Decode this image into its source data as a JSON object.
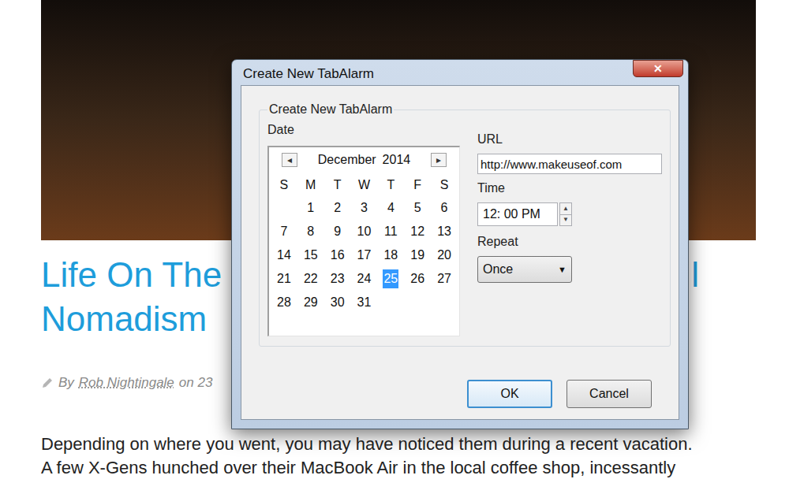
{
  "article": {
    "heading_lines": [
      "Life On The",
      "Nomadism"
    ],
    "heading_fragment": "l",
    "byline": {
      "prefix": "By",
      "author": "Rob Nightingale",
      "suffix": "on 23"
    },
    "body_lines": [
      "Depending on where you went, you may have noticed them during a recent vacation.",
      "A few X-Gens hunched over their MacBook Air in the local coffee shop, incessantly"
    ]
  },
  "window": {
    "title": "Create New TabAlarm",
    "close": "✕"
  },
  "group": {
    "title": "Create New TabAlarm"
  },
  "date_label": "Date",
  "calendar": {
    "prev": "◂",
    "next": "▸",
    "month": "December",
    "year": "2014",
    "weekdays": [
      "S",
      "M",
      "T",
      "W",
      "T",
      "F",
      "S"
    ],
    "weeks": [
      [
        null,
        {
          "day": "1",
          "selected": false
        },
        {
          "day": "2",
          "selected": false
        },
        {
          "day": "3",
          "selected": false
        },
        {
          "day": "4",
          "selected": false
        },
        {
          "day": "5",
          "selected": false
        },
        {
          "day": "6",
          "selected": false
        }
      ],
      [
        {
          "day": "7",
          "selected": false
        },
        {
          "day": "8",
          "selected": false
        },
        {
          "day": "9",
          "selected": false
        },
        {
          "day": "10",
          "selected": false
        },
        {
          "day": "11",
          "selected": false
        },
        {
          "day": "12",
          "selected": false
        },
        {
          "day": "13",
          "selected": false
        }
      ],
      [
        {
          "day": "14",
          "selected": false
        },
        {
          "day": "15",
          "selected": false
        },
        {
          "day": "16",
          "selected": false
        },
        {
          "day": "17",
          "selected": false
        },
        {
          "day": "18",
          "selected": false
        },
        {
          "day": "19",
          "selected": false
        },
        {
          "day": "20",
          "selected": false
        }
      ],
      [
        {
          "day": "21",
          "selected": false
        },
        {
          "day": "22",
          "selected": false
        },
        {
          "day": "23",
          "selected": false
        },
        {
          "day": "24",
          "selected": false
        },
        {
          "day": "25",
          "selected": true
        },
        {
          "day": "26",
          "selected": false
        },
        {
          "day": "27",
          "selected": false
        }
      ],
      [
        {
          "day": "28",
          "selected": false
        },
        {
          "day": "29",
          "selected": false
        },
        {
          "day": "30",
          "selected": false
        },
        {
          "day": "31",
          "selected": false
        },
        null,
        null,
        null
      ]
    ]
  },
  "url": {
    "label": "URL",
    "value": "http://www.makeuseof.com"
  },
  "time": {
    "label": "Time",
    "value": "12: 00 PM",
    "up": "▲",
    "down": "▼"
  },
  "repeat": {
    "label": "Repeat",
    "value": "Once",
    "arrow": "▼"
  },
  "buttons": [
    {
      "label": "OK",
      "focused": true
    },
    {
      "label": "Cancel",
      "focused": false
    }
  ]
}
